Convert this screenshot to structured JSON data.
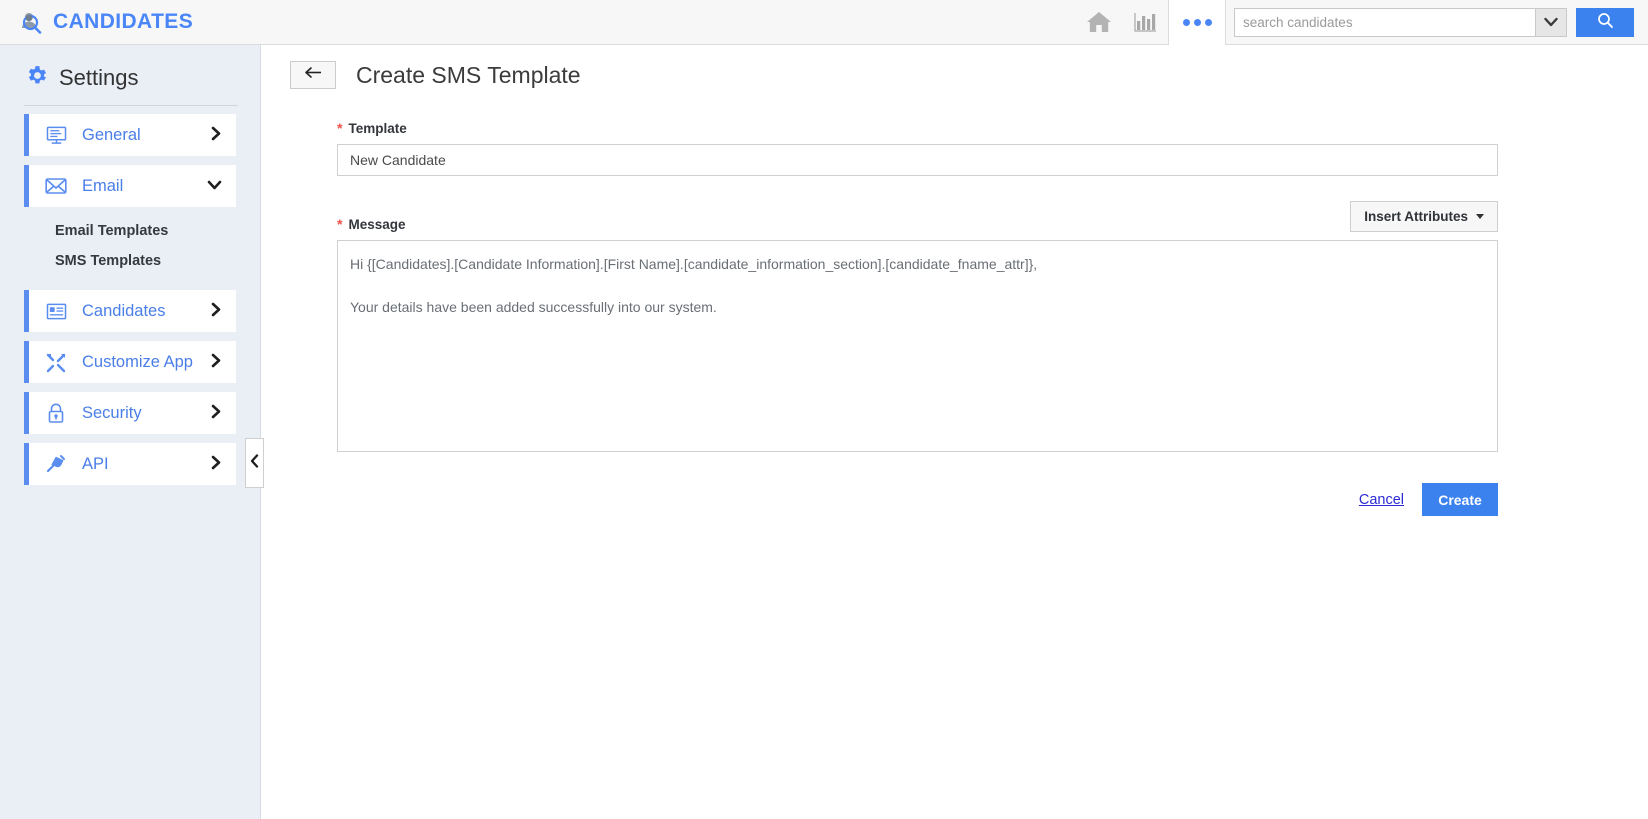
{
  "topbar": {
    "brand": "CANDIDATES",
    "brand_icon": "candidate-search-icon",
    "brand_color": "#4a86f7",
    "home_icon": "home-icon",
    "reports_icon": "bar-chart-icon",
    "more_icon": "more-dots-icon",
    "search": {
      "placeholder": "search candidates",
      "value": "",
      "dropdown_icon": "chevron-down-icon",
      "button_icon": "search-icon",
      "button_color": "#3b82ef"
    }
  },
  "sidebar": {
    "title": "Settings",
    "gear_icon": "gear-icon",
    "accent_color": "#5b8df0",
    "items": [
      {
        "label": "General",
        "icon": "monitor-icon",
        "chevron": "chevron-right-icon",
        "expanded": false
      },
      {
        "label": "Email",
        "icon": "envelope-icon",
        "chevron": "chevron-down-icon",
        "expanded": true
      },
      {
        "label": "Candidates",
        "icon": "card-list-icon",
        "chevron": "chevron-right-icon",
        "expanded": false
      },
      {
        "label": "Customize App",
        "icon": "tools-icon",
        "chevron": "chevron-right-icon",
        "expanded": false
      },
      {
        "label": "Security",
        "icon": "lock-icon",
        "chevron": "chevron-right-icon",
        "expanded": false
      },
      {
        "label": "API",
        "icon": "plug-icon",
        "chevron": "chevron-right-icon",
        "expanded": false
      }
    ],
    "email_subitems": [
      {
        "label": "Email Templates"
      },
      {
        "label": "SMS Templates"
      }
    ],
    "collapse_icon": "chevron-left-icon"
  },
  "main": {
    "back_icon": "arrow-left-icon",
    "title": "Create SMS Template",
    "template_field": {
      "label": "Template",
      "required_mark": "*",
      "value": "New Candidate",
      "placeholder": ""
    },
    "message_field": {
      "label": "Message",
      "required_mark": "*",
      "value": "Hi {[Candidates].[Candidate Information].[First Name].[candidate_information_section].[candidate_fname_attr]},\n\nYour details have been added successfully into our system.",
      "placeholder": ""
    },
    "insert_attributes_label": "Insert Attributes",
    "cancel_label": "Cancel",
    "create_label": "Create"
  }
}
